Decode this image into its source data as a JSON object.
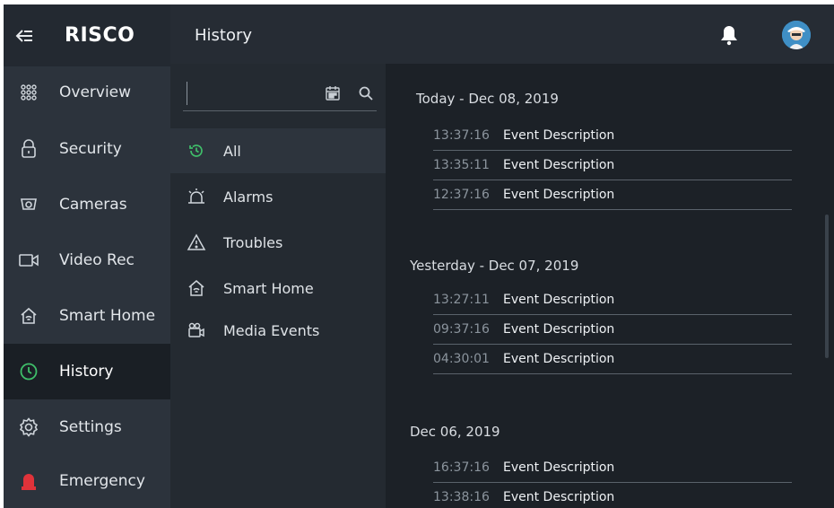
{
  "brand": {
    "logo_text": "RISCO"
  },
  "header": {
    "title": "History"
  },
  "nav": {
    "items": [
      {
        "label": "Overview",
        "icon": "grid-icon"
      },
      {
        "label": "Security",
        "icon": "lock-icon"
      },
      {
        "label": "Cameras",
        "icon": "camera-icon"
      },
      {
        "label": "Video Rec",
        "icon": "video-icon"
      },
      {
        "label": "Smart Home",
        "icon": "smart-home-icon"
      },
      {
        "label": "History",
        "icon": "history-icon",
        "active": true
      },
      {
        "label": "Settings",
        "icon": "gear-icon"
      },
      {
        "label": "Emergency",
        "icon": "siren-icon"
      }
    ]
  },
  "search": {
    "value": "",
    "placeholder": ""
  },
  "filters": {
    "items": [
      {
        "label": "All",
        "icon": "history-icon",
        "selected": true
      },
      {
        "label": "Alarms",
        "icon": "alarm-icon"
      },
      {
        "label": "Troubles",
        "icon": "warning-icon"
      },
      {
        "label": "Smart Home",
        "icon": "smart-home-icon"
      },
      {
        "label": "Media Events",
        "icon": "media-icon"
      }
    ]
  },
  "days": [
    {
      "heading": "Today - Dec 08, 2019",
      "events": [
        {
          "time": "13:37:16",
          "desc": "Event Description"
        },
        {
          "time": "13:35:11",
          "desc": "Event Description"
        },
        {
          "time": "12:37:16",
          "desc": "Event Description"
        }
      ]
    },
    {
      "heading": "Yesterday - Dec 07, 2019",
      "events": [
        {
          "time": "13:27:11",
          "desc": "Event Description"
        },
        {
          "time": "09:37:16",
          "desc": "Event Description"
        },
        {
          "time": "04:30:01",
          "desc": "Event Description"
        }
      ]
    },
    {
      "heading": "Dec 06, 2019",
      "events": [
        {
          "time": "16:37:16",
          "desc": "Event Description"
        },
        {
          "time": "13:38:16",
          "desc": "Event Description"
        }
      ]
    }
  ],
  "colors": {
    "accent_green": "#3fbf6a",
    "emergency_red": "#e0333a",
    "avatar_blue": "#3f8fc5"
  }
}
